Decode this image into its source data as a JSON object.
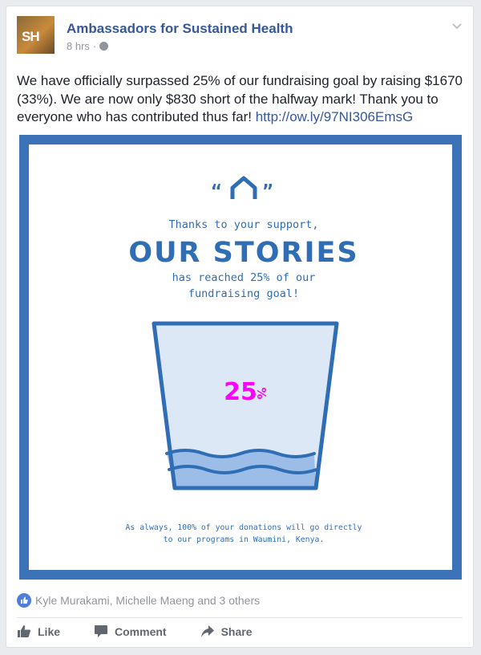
{
  "post": {
    "page_name": "Ambassadors for Sustained Health",
    "avatar_text": "SH",
    "time": "8 hrs",
    "separator": "·",
    "text": "We have officially surpassed 25% of our fundraising goal by raising $1670 (33%). We are now only $830 short of the halfway mark! Thank you to everyone who has contributed thus far!",
    "link": "http://ow.ly/97NI306EmsG"
  },
  "graphic": {
    "quote_open": "“",
    "quote_close": "”",
    "line1": "Thanks to your support,",
    "headline": "OUR STORIES",
    "line2": "has reached 25% of our",
    "line3": "fundraising goal!",
    "percent": "25",
    "percent_sign": "%",
    "footer1": "As always, 100% of your donations will go directly",
    "footer2": "to our programs in Waumini, Kenya.",
    "fill_level": 0.25,
    "colors": {
      "frame": "#3c73b8",
      "cup_fill": "#dde8f6",
      "water": "#9dbde9",
      "percent": "#ff00ff",
      "text": "#2f6db5"
    }
  },
  "reactions": {
    "names": "Kyle Murakami, Michelle Maeng and 3 others"
  },
  "actions": {
    "like": "Like",
    "comment": "Comment",
    "share": "Share"
  }
}
